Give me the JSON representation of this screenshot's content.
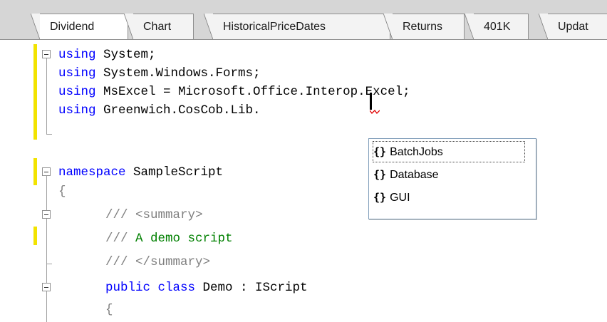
{
  "tabs": [
    {
      "label": "Dividend",
      "active": true
    },
    {
      "label": "Chart",
      "active": false
    },
    {
      "label": "HistoricalPriceDates",
      "active": false
    },
    {
      "label": "Returns",
      "active": false
    },
    {
      "label": "401K",
      "active": false
    },
    {
      "label": "Updat",
      "active": false
    }
  ],
  "code": {
    "line1": {
      "kw": "using",
      "rest": " System;"
    },
    "line2": {
      "kw": "using",
      "rest": " System.Windows.Forms;"
    },
    "line3": {
      "kw": "using",
      "rest": " MsExcel = Microsoft.Office.Interop.Excel;"
    },
    "line4": {
      "kw": "using",
      "rest": " Greenwich.CosCob.Lib."
    },
    "line6": {
      "kw": "namespace",
      "rest": " SampleScript"
    },
    "line7": {
      "text": "{"
    },
    "line8": {
      "prefix": "///",
      "tag": " <summary>"
    },
    "line9": {
      "prefix": "///",
      "comment": " A demo script"
    },
    "line10": {
      "prefix": "///",
      "tag": " </summary>"
    },
    "line11": {
      "kw": "public class",
      "rest": " Demo : IScript"
    },
    "line12": {
      "text": "{"
    }
  },
  "autocomplete": {
    "icon": "{}",
    "icon_name": "namespace-icon",
    "items": [
      "BatchJobs",
      "Database",
      "GUI"
    ],
    "selected_index": 0
  },
  "colors": {
    "keyword": "#0000ff",
    "comment_green": "#008000",
    "comment_gray": "#808080",
    "change_marker": "#f2e300"
  }
}
